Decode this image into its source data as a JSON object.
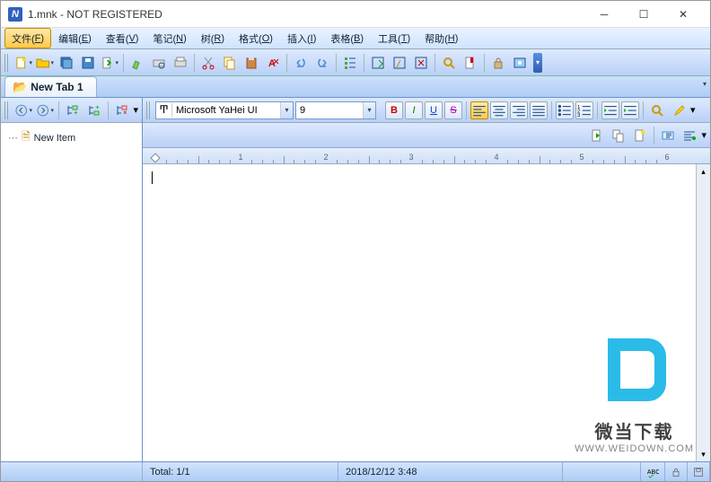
{
  "window": {
    "title": "1.mnk - NOT REGISTERED",
    "app_initial": "N"
  },
  "menu": {
    "items": [
      {
        "label": "文件",
        "accel": "F",
        "selected": true
      },
      {
        "label": "编辑",
        "accel": "E"
      },
      {
        "label": "查看",
        "accel": "V"
      },
      {
        "label": "笔记",
        "accel": "N"
      },
      {
        "label": "树",
        "accel": "R"
      },
      {
        "label": "格式",
        "accel": "O"
      },
      {
        "label": "插入",
        "accel": "I"
      },
      {
        "label": "表格",
        "accel": "B"
      },
      {
        "label": "工具",
        "accel": "T"
      },
      {
        "label": "帮助",
        "accel": "H"
      }
    ]
  },
  "tabs": [
    {
      "label": "New Tab 1"
    }
  ],
  "tree": {
    "items": [
      {
        "label": "New Item"
      }
    ]
  },
  "format": {
    "font_name": "Microsoft YaHei UI",
    "font_size": "9",
    "bold": "B",
    "italic": "I",
    "underline": "U",
    "strike": "S"
  },
  "ruler": {
    "labels": [
      "1",
      "2",
      "3",
      "4",
      "5",
      "6"
    ]
  },
  "status": {
    "total": "Total: 1/1",
    "datetime": "2018/12/12 3:48"
  },
  "watermark": {
    "title": "微当下载",
    "url": "WWW.WEIDOWN.COM"
  }
}
